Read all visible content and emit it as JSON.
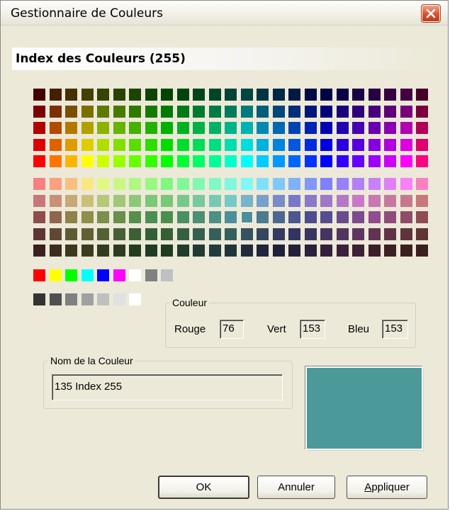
{
  "window": {
    "title": "Gestionnaire de Couleurs"
  },
  "header": {
    "title": "Index des Couleurs (255)"
  },
  "palette": {
    "main_rows_top": [
      [
        "#440000",
        "#442000",
        "#443000",
        "#444000",
        "#354400",
        "#284400",
        "#1a4400",
        "#0c4400",
        "#004400",
        "#00440c",
        "#00441a",
        "#004428",
        "#004435",
        "#004444",
        "#003544",
        "#002844",
        "#001a44",
        "#000c44",
        "#000044",
        "#0c0044",
        "#1a0044",
        "#280044",
        "#350044",
        "#440044",
        "#44002a"
      ],
      [
        "#7a0000",
        "#7a3000",
        "#7a5000",
        "#7a6e00",
        "#5e7a00",
        "#477a00",
        "#2e7a00",
        "#177a00",
        "#007a00",
        "#007a17",
        "#007a2e",
        "#007a47",
        "#007a5e",
        "#007a7a",
        "#005e7a",
        "#00477a",
        "#002e7a",
        "#00177a",
        "#00007a",
        "#17007a",
        "#2e007a",
        "#47007a",
        "#5e007a",
        "#7a007a",
        "#7a003d"
      ],
      [
        "#b20000",
        "#b24a00",
        "#b27800",
        "#b2a000",
        "#8ab200",
        "#68b200",
        "#44b200",
        "#22b200",
        "#00b200",
        "#00b222",
        "#00b244",
        "#00b268",
        "#00b28a",
        "#00b2b2",
        "#008ab2",
        "#0068b2",
        "#0044b2",
        "#0022b2",
        "#0000b2",
        "#2200b2",
        "#4400b2",
        "#6800b2",
        "#8a00b2",
        "#b200b2",
        "#b20058"
      ],
      [
        "#de0000",
        "#de6200",
        "#de9c00",
        "#dece00",
        "#b0de00",
        "#84de00",
        "#58de00",
        "#2cde00",
        "#00de00",
        "#00de2c",
        "#00de58",
        "#00de84",
        "#00deb0",
        "#00dede",
        "#00b0de",
        "#0084de",
        "#0058de",
        "#002cde",
        "#0000de",
        "#2c00de",
        "#5800de",
        "#8400de",
        "#b000de",
        "#de00de",
        "#de006e"
      ],
      [
        "#ff0000",
        "#ff7400",
        "#ffb400",
        "#ffff00",
        "#ccff00",
        "#99ff00",
        "#66ff00",
        "#33ff00",
        "#00ff00",
        "#00ff33",
        "#00ff66",
        "#00ff99",
        "#00ffcc",
        "#00ffff",
        "#00ccff",
        "#0099ff",
        "#0066ff",
        "#0033ff",
        "#0000ff",
        "#3300ff",
        "#6600ff",
        "#9900ff",
        "#cc00ff",
        "#ff00ff",
        "#ff0080"
      ]
    ],
    "main_rows_bottom": [
      [
        "#f88080",
        "#f8a080",
        "#f8c080",
        "#f8e880",
        "#e0f880",
        "#c8f880",
        "#b0f880",
        "#98f880",
        "#80f880",
        "#80f898",
        "#80f8b0",
        "#80f8c8",
        "#80f8e0",
        "#80f8f8",
        "#80e0f8",
        "#80c8f8",
        "#80b0f8",
        "#8098f8",
        "#8080f8",
        "#9880f8",
        "#b080f8",
        "#c880f8",
        "#e080f8",
        "#f880f8",
        "#f880c0"
      ],
      [
        "#c87878",
        "#c89078",
        "#c8a878",
        "#c8c078",
        "#b4c878",
        "#a0c878",
        "#8cc878",
        "#7ac878",
        "#78c878",
        "#78c88c",
        "#78c8a0",
        "#78c8b4",
        "#78c8c8",
        "#78b4c8",
        "#78a0c8",
        "#788cc8",
        "#7878c8",
        "#8c78c8",
        "#a078c8",
        "#b478c8",
        "#c878c8",
        "#c878b4",
        "#c878a0",
        "#c8788c",
        "#c87878"
      ],
      [
        "#8f4c4c",
        "#8f664c",
        "#8f804c",
        "#8f8f4c",
        "#7a8f4c",
        "#688f4c",
        "#568f4c",
        "#4c8f50",
        "#4c8f4c",
        "#4c8f62",
        "#4c8f74",
        "#4c8f86",
        "#4c8f99",
        "#4c8f99",
        "#4c7a8f",
        "#4c688f",
        "#4c568f",
        "#4c4c8f",
        "#564c8f",
        "#684c8f",
        "#7a4c8f",
        "#8f4c8f",
        "#8f4c7a",
        "#8f4c68",
        "#8f4c56"
      ],
      [
        "#603434",
        "#604834",
        "#605a34",
        "#606034",
        "#526034",
        "#466034",
        "#3a6034",
        "#346038",
        "#346034",
        "#346044",
        "#346050",
        "#34605c",
        "#346060",
        "#345260",
        "#344660",
        "#343a60",
        "#343460",
        "#3a3460",
        "#463460",
        "#523460",
        "#603460",
        "#603452",
        "#603446",
        "#60343a",
        "#603434"
      ],
      [
        "#3c2020",
        "#3c2c20",
        "#3c3820",
        "#3c3c20",
        "#343c20",
        "#2c3c20",
        "#243c20",
        "#203c24",
        "#203c20",
        "#203c2c",
        "#203c34",
        "#203c3c",
        "#20343c",
        "#202c3c",
        "#20243c",
        "#20203c",
        "#24203c",
        "#2c203c",
        "#34203c",
        "#3c203c",
        "#3c2034",
        "#3c202c",
        "#3c2024",
        "#3c2020",
        "#3c2020"
      ]
    ],
    "selected_cell": [
      2,
      13
    ],
    "basic_colors": [
      "#ff0000",
      "#ffff00",
      "#00ff00",
      "#00ffff",
      "#0000ff",
      "#ff00ff",
      "#ffffff",
      "#808080",
      "#c0c0c0"
    ],
    "gray_colors": [
      "#333333",
      "#505050",
      "#808080",
      "#a0a0a0",
      "#c0c0c0",
      "#e0e0e0",
      "#ffffff"
    ]
  },
  "color_group": {
    "legend": "Couleur",
    "red_label": "Rouge",
    "red_value": "76",
    "green_label": "Vert",
    "green_value": "153",
    "blue_label": "Bleu",
    "blue_value": "153"
  },
  "name_group": {
    "legend": "Nom de la Couleur",
    "value": "135 Index 255"
  },
  "preview": {
    "color": "#4c9999"
  },
  "buttons": {
    "ok": "OK",
    "cancel": "Annuler",
    "apply_first_letter": "A",
    "apply_rest": "ppliquer"
  },
  "colors": {
    "dialog_bg": "#ece9d8",
    "close_red": "#d9522f"
  }
}
